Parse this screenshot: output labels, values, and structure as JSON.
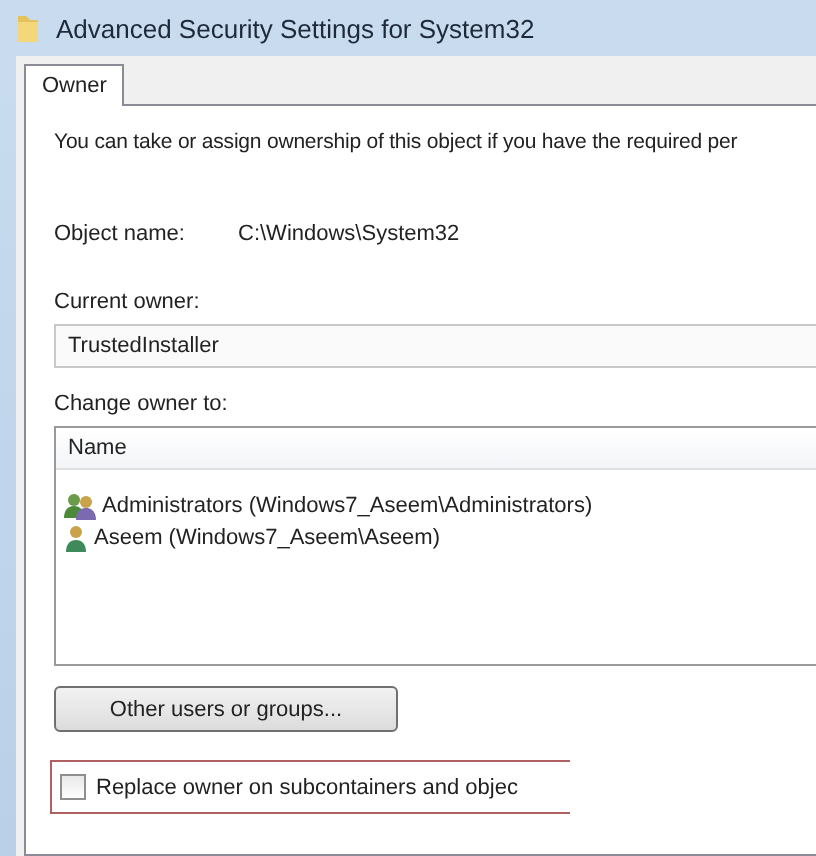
{
  "window": {
    "title": "Advanced Security Settings for System32"
  },
  "tabs": [
    {
      "label": "Owner",
      "selected": true
    }
  ],
  "intro": "You can take or assign ownership of this object if you have the required per",
  "object_name": {
    "label": "Object name:",
    "value": "C:\\Windows\\System32"
  },
  "current_owner": {
    "label": "Current owner:",
    "value": "TrustedInstaller"
  },
  "change_owner": {
    "label": "Change owner to:",
    "columns": [
      "Name"
    ],
    "rows": [
      {
        "kind": "group",
        "name": "Administrators (Windows7_Aseem\\Administrators)",
        "selected": false
      },
      {
        "kind": "user",
        "name": "Aseem (Windows7_Aseem\\Aseem)",
        "selected": false
      }
    ]
  },
  "buttons": [
    "Other users or groups..."
  ],
  "replace_owner": {
    "label": "Replace owner on subcontainers and objec",
    "checked": false
  }
}
